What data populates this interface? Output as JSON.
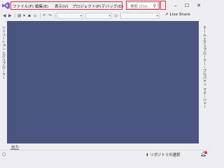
{
  "menu": {
    "items": [
      "ファイル(F)",
      "編集(E)",
      "表示(V)",
      "プロジェクト(P)",
      "デバッグ(D)"
    ]
  },
  "search": {
    "placeholder": "検索 (Ctrl..."
  },
  "toolbar": {
    "live_share_label": "Live Share"
  },
  "side_panels": {
    "left": "ソリューション エクスプローラー",
    "right": "チーム エクスプローラー・プロパティ マネージャー"
  },
  "bottom_panel": {
    "tab_label": "出力"
  },
  "status": {
    "repo_label": "リポジトリの選択"
  },
  "colors": {
    "workspace": "#4a5581",
    "highlight": "#e0303a"
  }
}
